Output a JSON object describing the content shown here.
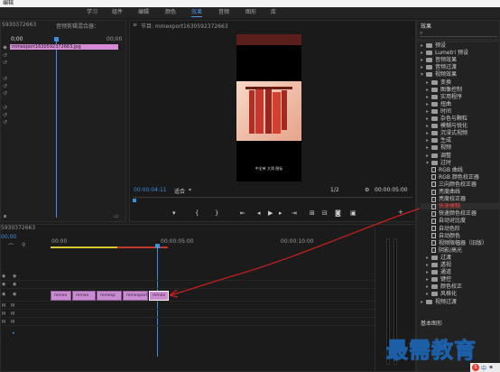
{
  "app": {
    "title": "编辑"
  },
  "workspace_tabs": [
    "学习",
    "组件",
    "编辑",
    "颜色",
    "效果",
    "音频",
    "图形",
    "库"
  ],
  "source_panel": {
    "title": "5930372663",
    "tab": "音频剪辑混合器：",
    "time_start": "0;00",
    "time_end": "00;00",
    "clip_name": "mmexport1630592372663.jpg"
  },
  "program_panel": {
    "title": "节目: mmexport1630592372663",
    "timecode_current": "00:00:04:11",
    "fit": "适合",
    "quality": "1/2",
    "timecode_duration": "00:00:05:00",
    "overlay_text": "中全单 大哥 图标"
  },
  "timeline": {
    "title": "5930372663",
    "timecode": "00;00",
    "ruler": [
      "00:00",
      "00:00:05:00",
      "00:00:10:00"
    ],
    "clips": [
      "mmex",
      "mmex",
      "mmexp",
      "mmexport",
      "mmex"
    ]
  },
  "effects_panel": {
    "title": "效果",
    "footer": "基本图形",
    "items": [
      {
        "label": "预设",
        "level": 0,
        "type": "folder",
        "open": false
      },
      {
        "label": "Lumetri 预设",
        "level": 0,
        "type": "folder",
        "open": false
      },
      {
        "label": "音频效果",
        "level": 0,
        "type": "folder",
        "open": false
      },
      {
        "label": "音频过渡",
        "level": 0,
        "type": "folder",
        "open": false
      },
      {
        "label": "视频效果",
        "level": 0,
        "type": "folder",
        "open": true
      },
      {
        "label": "变换",
        "level": 1,
        "type": "folder",
        "open": false
      },
      {
        "label": "图像控制",
        "level": 1,
        "type": "folder",
        "open": false
      },
      {
        "label": "实用程序",
        "level": 1,
        "type": "folder",
        "open": false
      },
      {
        "label": "扭曲",
        "level": 1,
        "type": "folder",
        "open": false
      },
      {
        "label": "时间",
        "level": 1,
        "type": "folder",
        "open": false
      },
      {
        "label": "杂色与颗粒",
        "level": 1,
        "type": "folder",
        "open": false
      },
      {
        "label": "模糊与锐化",
        "level": 1,
        "type": "folder",
        "open": false
      },
      {
        "label": "沉浸式视频",
        "level": 1,
        "type": "folder",
        "open": false
      },
      {
        "label": "生成",
        "level": 1,
        "type": "folder",
        "open": false
      },
      {
        "label": "视频",
        "level": 1,
        "type": "folder",
        "open": false
      },
      {
        "label": "调整",
        "level": 1,
        "type": "folder",
        "open": false
      },
      {
        "label": "过时",
        "level": 1,
        "type": "folder",
        "open": true
      },
      {
        "label": "RGB 曲线",
        "level": 2,
        "type": "fx"
      },
      {
        "label": "RGB 颜色校正器",
        "level": 2,
        "type": "fx"
      },
      {
        "label": "三向颜色校正器",
        "level": 2,
        "type": "fx"
      },
      {
        "label": "亮度曲线",
        "level": 2,
        "type": "fx"
      },
      {
        "label": "亮度校正器",
        "level": 2,
        "type": "fx"
      },
      {
        "label": "快速模糊",
        "level": 2,
        "type": "fx",
        "highlighted": true
      },
      {
        "label": "快速颜色校正器",
        "level": 2,
        "type": "fx"
      },
      {
        "label": "自动对比度",
        "level": 2,
        "type": "fx"
      },
      {
        "label": "自动色阶",
        "level": 2,
        "type": "fx"
      },
      {
        "label": "自动颜色",
        "level": 2,
        "type": "fx"
      },
      {
        "label": "视频限幅器（旧版）",
        "level": 2,
        "type": "fx"
      },
      {
        "label": "阴影/高光",
        "level": 2,
        "type": "fx"
      },
      {
        "label": "过渡",
        "level": 1,
        "type": "folder",
        "open": false
      },
      {
        "label": "透视",
        "level": 1,
        "type": "folder",
        "open": false
      },
      {
        "label": "通道",
        "level": 1,
        "type": "folder",
        "open": false
      },
      {
        "label": "键控",
        "level": 1,
        "type": "folder",
        "open": false
      },
      {
        "label": "颜色校正",
        "level": 1,
        "type": "folder",
        "open": false
      },
      {
        "label": "风格化",
        "level": 1,
        "type": "folder",
        "open": false
      },
      {
        "label": "视频过渡",
        "level": 0,
        "type": "folder",
        "open": false
      }
    ]
  },
  "watermark": "最需教育",
  "tray_label": "中"
}
